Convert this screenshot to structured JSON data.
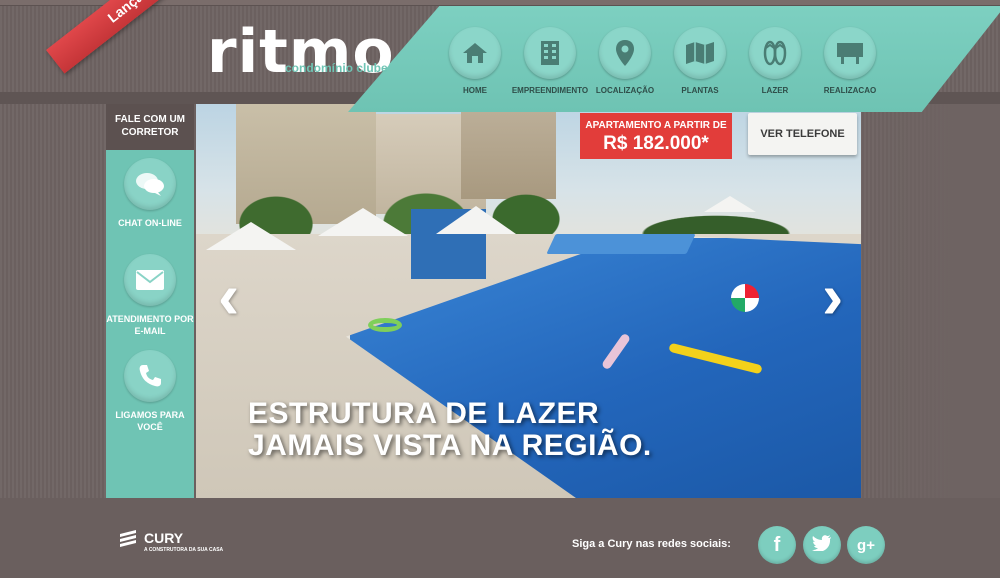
{
  "brand": {
    "ribbon": "Lançamento",
    "logo_word": "ritmo",
    "logo_sub": "condomínio clube"
  },
  "nav": {
    "items": [
      {
        "label": "HOME",
        "icon": "house-icon"
      },
      {
        "label": "EMPREENDIMENTO",
        "icon": "building-icon"
      },
      {
        "label": "LOCALIZAÇÃO",
        "icon": "map-pin-icon"
      },
      {
        "label": "PLANTAS",
        "icon": "map-icon"
      },
      {
        "label": "LAZER",
        "icon": "flip-flops-icon"
      },
      {
        "label": "REALIZACAO",
        "icon": "signboard-icon"
      }
    ]
  },
  "contact": {
    "header": "FALE COM UM CORRETOR",
    "items": [
      {
        "label": "CHAT ON-LINE",
        "icon": "chat-bubbles-icon"
      },
      {
        "label": "ATENDIMENTO POR E-MAIL",
        "icon": "envelope-icon"
      },
      {
        "label": "LIGAMOS PARA VOCÊ",
        "icon": "phone-icon"
      }
    ]
  },
  "promo": {
    "price_top": "APARTAMENTO A PARTIR DE",
    "price_value": "R$ 182.000*",
    "phone_button": "VER TELEFONE"
  },
  "hero": {
    "line1": "ESTRUTURA DE LAZER",
    "line2": "JAMAIS VISTA NA REGIÃO.",
    "prev_arrow": "‹",
    "next_arrow": "›"
  },
  "footer": {
    "cury_word": "CURY",
    "cury_sub": "A CONSTRUTORA DA SUA CASA",
    "social_text": "Siga a Cury nas redes sociais:",
    "social": [
      {
        "label": "f",
        "icon": "facebook-icon"
      },
      {
        "label": "t",
        "icon": "twitter-icon"
      },
      {
        "label": "g+",
        "icon": "google-plus-icon"
      }
    ]
  },
  "colors": {
    "teal": "#6fc4b4",
    "brown": "#6e6362",
    "red": "#e23d3a"
  }
}
